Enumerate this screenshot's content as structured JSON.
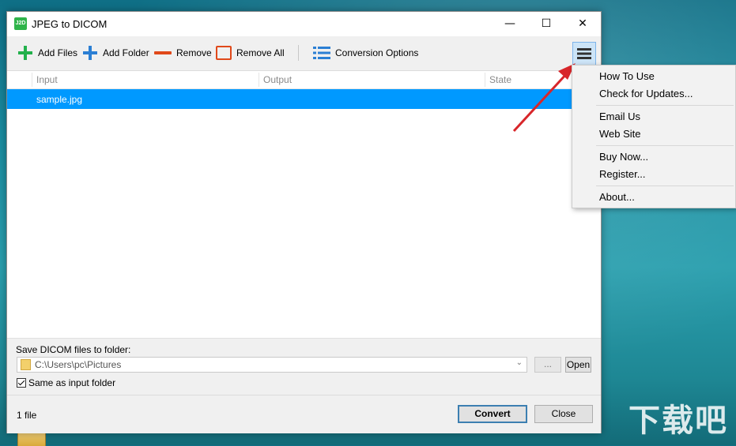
{
  "window": {
    "app_icon_text": "J2D",
    "title": "JPEG to DICOM",
    "controls": {
      "minimize": "—",
      "maximize": "☐",
      "close": "✕"
    }
  },
  "toolbar": {
    "add_files": "Add Files",
    "add_folder": "Add Folder",
    "remove": "Remove",
    "remove_all": "Remove All",
    "conversion_options": "Conversion Options",
    "menu_icon": "hamburger-icon",
    "colors": {
      "add": "#22b14c",
      "add_folder": "#2b7fd4",
      "remove": "#e0491a",
      "options": "#2b7fd4"
    }
  },
  "file_list": {
    "columns": [
      "Input",
      "Output",
      "State"
    ],
    "rows": [
      {
        "input": "sample.jpg",
        "output": "",
        "state": ""
      }
    ],
    "selected_color": "#0099ff"
  },
  "save": {
    "label": "Save DICOM files to folder:",
    "path": "C:\\Users\\pc\\Pictures",
    "browse": "...",
    "open": "Open",
    "same_as_input": "Same as input folder",
    "same_as_input_checked": true
  },
  "status": {
    "file_count": "1 file",
    "convert": "Convert",
    "close": "Close"
  },
  "menu": {
    "groups": [
      [
        "How To Use",
        "Check for Updates..."
      ],
      [
        "Email Us",
        "Web Site"
      ],
      [
        "Buy Now...",
        "Register..."
      ],
      [
        "About..."
      ]
    ]
  },
  "desktop": {
    "watermark": "下载吧"
  }
}
